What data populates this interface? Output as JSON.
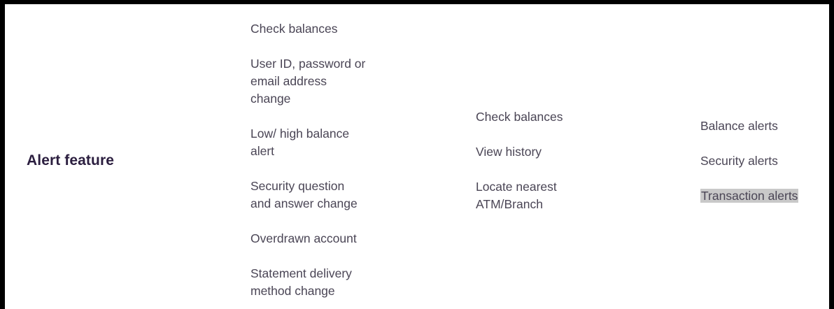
{
  "row": {
    "label": "Alert feature"
  },
  "columns": [
    {
      "items": [
        [
          "Check balances"
        ],
        [
          "User ID, password or",
          "email address",
          "change"
        ],
        [
          "Low/ high balance",
          "alert"
        ],
        [
          "Security question",
          "and answer change"
        ],
        [
          "Overdrawn account"
        ],
        [
          "Statement delivery",
          "method change"
        ]
      ]
    },
    {
      "items": [
        [
          "Check balances"
        ],
        [
          "View history"
        ],
        [
          "Locate nearest",
          "ATM/Branch"
        ]
      ]
    },
    {
      "items": [
        [
          "Balance alerts"
        ],
        [
          "Security alerts"
        ],
        [
          "Transaction alerts"
        ]
      ],
      "selected_item": "Transaction alerts"
    }
  ],
  "colors": {
    "label": "#2b1e3f",
    "text": "#4a4555",
    "selection": "#c9c9c9",
    "border": "#000000"
  }
}
